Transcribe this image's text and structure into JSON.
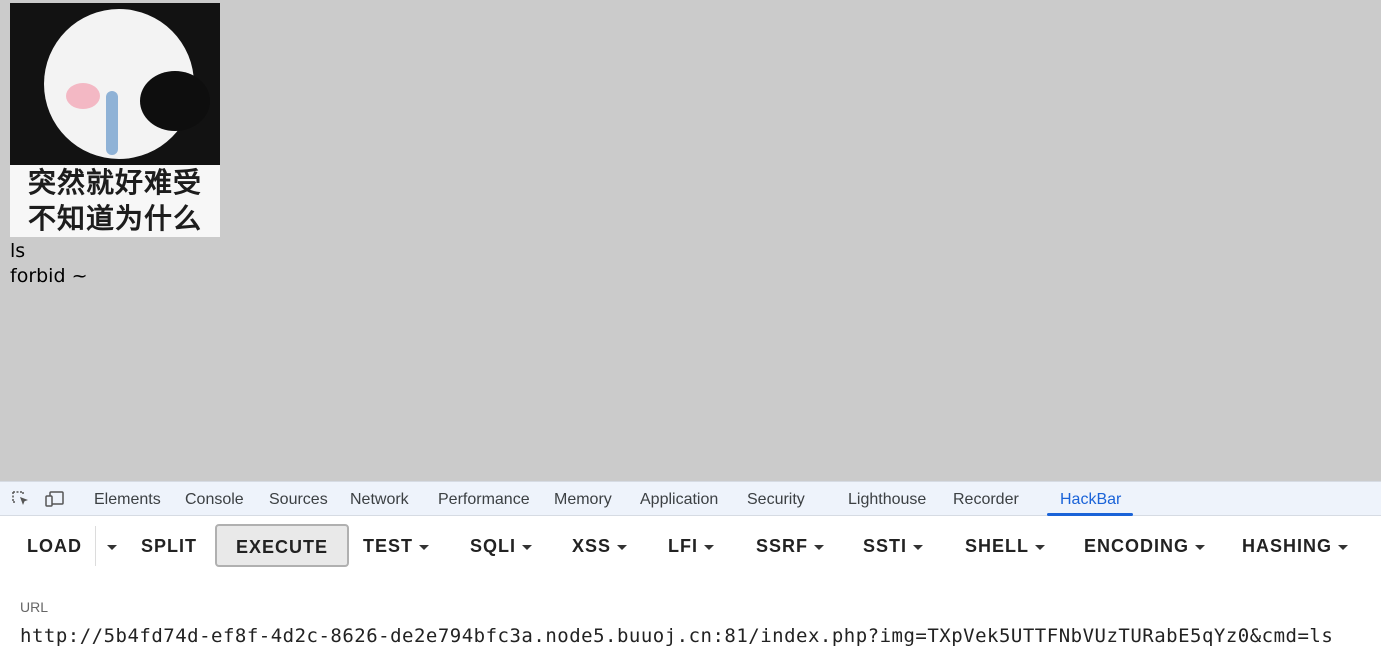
{
  "page": {
    "meme_caption": [
      "突然就好难受",
      "不知道为什么"
    ],
    "output_lines": [
      "ls",
      "forbid ~"
    ]
  },
  "devtools": {
    "icons": [
      "inspect-element-icon",
      "device-toolbar-icon"
    ],
    "tabs": [
      "Elements",
      "Console",
      "Sources",
      "Network",
      "Performance",
      "Memory",
      "Application",
      "Security",
      "Lighthouse",
      "Recorder",
      "HackBar"
    ],
    "active_tab": "HackBar",
    "accent_color": "#1a63d8"
  },
  "hackbar": {
    "load": "LOAD",
    "split": "SPLIT",
    "execute": "EXECUTE",
    "menus": [
      "TEST",
      "SQLI",
      "XSS",
      "LFI",
      "SSRF",
      "SSTI",
      "SHELL",
      "ENCODING",
      "HASHING"
    ],
    "url_label": "URL",
    "url_value": "http://5b4fd74d-ef8f-4d2c-8626-de2e794bfc3a.node5.buuoj.cn:81/index.php?img=TXpVek5UTTFNbVUzTURabE5qYz0&cmd=ls"
  }
}
